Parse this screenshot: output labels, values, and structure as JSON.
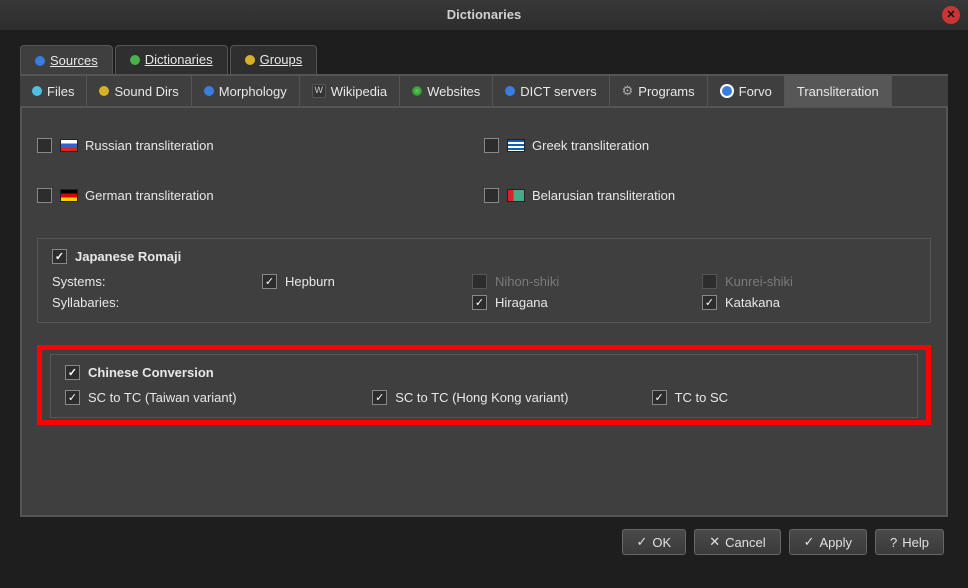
{
  "title": "Dictionaries",
  "top_tabs": {
    "sources": "Sources",
    "dictionaries": "Dictionaries",
    "groups": "Groups"
  },
  "inner_tabs": {
    "files": "Files",
    "sound_dirs": "Sound Dirs",
    "morphology": "Morphology",
    "wikipedia": "Wikipedia",
    "websites": "Websites",
    "dict_servers": "DICT servers",
    "programs": "Programs",
    "forvo": "Forvo",
    "transliteration": "Transliteration"
  },
  "cb": {
    "russian": "Russian transliteration",
    "greek": "Greek transliteration",
    "german": "German transliteration",
    "belarusian": "Belarusian transliteration"
  },
  "jp": {
    "title": "Japanese Romaji",
    "systems_label": "Systems:",
    "syllabaries_label": "Syllabaries:",
    "hepburn": "Hepburn",
    "nihon": "Nihon-shiki",
    "kunrei": "Kunrei-shiki",
    "hiragana": "Hiragana",
    "katakana": "Katakana"
  },
  "cn": {
    "title": "Chinese Conversion",
    "sc_tc_tw": "SC to TC (Taiwan variant)",
    "sc_tc_hk": "SC to TC (Hong Kong variant)",
    "tc_sc": "TC to SC"
  },
  "buttons": {
    "ok": "OK",
    "cancel": "Cancel",
    "apply": "Apply",
    "help": "Help"
  }
}
